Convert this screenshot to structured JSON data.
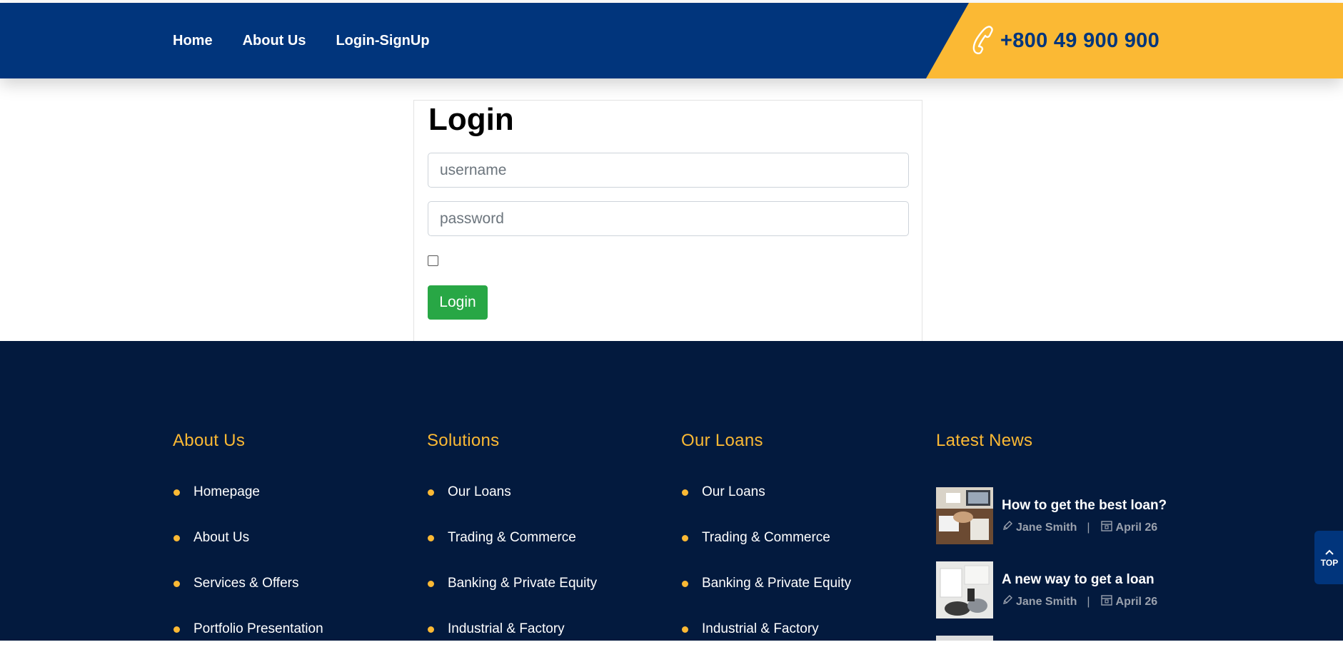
{
  "header": {
    "nav": [
      {
        "label": "Home"
      },
      {
        "label": "About Us"
      },
      {
        "label": "Login-SignUp"
      }
    ],
    "phone": "+800 49 900 900",
    "colors": {
      "primary": "#01357c",
      "accent": "#fbb934"
    }
  },
  "login": {
    "title": "Login",
    "username_placeholder": "username",
    "password_placeholder": "password",
    "remember_checked": false,
    "button_label": "Login"
  },
  "footer": {
    "about": {
      "title": "About Us",
      "items": [
        "Homepage",
        "About Us",
        "Services & Offers",
        "Portfolio Presentation"
      ]
    },
    "solutions": {
      "title": "Solutions",
      "items": [
        "Our Loans",
        "Trading & Commerce",
        "Banking & Private Equity",
        "Industrial & Factory"
      ]
    },
    "loans": {
      "title": "Our Loans",
      "items": [
        "Our Loans",
        "Trading & Commerce",
        "Banking & Private Equity",
        "Industrial & Factory"
      ]
    },
    "news": {
      "title": "Latest News",
      "items": [
        {
          "title": "How to get the best loan?",
          "author": "Jane Smith",
          "date": "April 26"
        },
        {
          "title": "A new way to get a loan",
          "author": "Jane Smith",
          "date": "April 26"
        }
      ]
    }
  },
  "totop": {
    "label": "TOP"
  }
}
